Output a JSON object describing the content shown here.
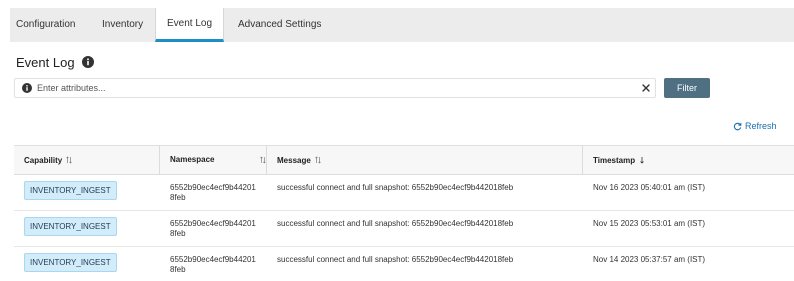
{
  "tabs": [
    {
      "label": "Configuration"
    },
    {
      "label": "Inventory"
    },
    {
      "label": "Event Log"
    },
    {
      "label": "Advanced Settings"
    }
  ],
  "page": {
    "title": "Event Log"
  },
  "filter": {
    "placeholder": "Enter attributes...",
    "value": "",
    "button_label": "Filter"
  },
  "refresh": {
    "label": "Refresh"
  },
  "table": {
    "headers": [
      "Capability",
      "Namespace",
      "Message",
      "Timestamp"
    ],
    "rows": [
      {
        "capability": "INVENTORY_INGEST",
        "namespace": "6552b90ec4ecf9b442018feb",
        "message": "successful connect and full snapshot: 6552b90ec4ecf9b442018feb",
        "timestamp": "Nov 16 2023 05:40:01 am (IST)"
      },
      {
        "capability": "INVENTORY_INGEST",
        "namespace": "6552b90ec4ecf9b442018feb",
        "message": "successful connect and full snapshot: 6552b90ec4ecf9b442018feb",
        "timestamp": "Nov 15 2023 05:53:01 am (IST)"
      },
      {
        "capability": "INVENTORY_INGEST",
        "namespace": "6552b90ec4ecf9b442018feb",
        "message": "successful connect and full snapshot: 6552b90ec4ecf9b442018feb",
        "timestamp": "Nov 14 2023 05:37:57 am (IST)"
      }
    ]
  },
  "colors": {
    "accent": "#1a8fc9",
    "filter_button": "#4f6f83",
    "badge_bg": "#d2ecfa",
    "link": "#1a6fb0"
  }
}
